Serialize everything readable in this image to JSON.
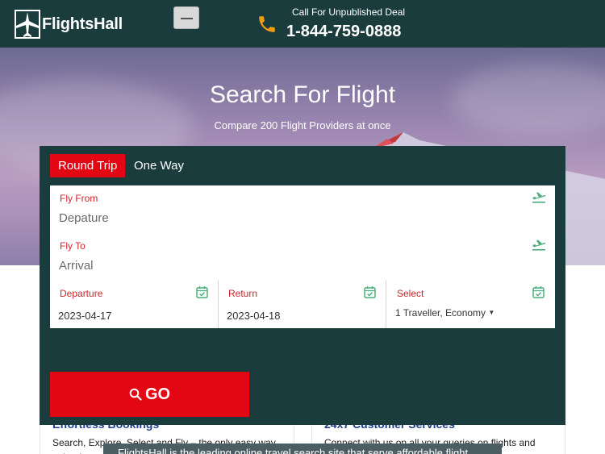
{
  "header": {
    "brand": "FlightsHall",
    "call_label": "Call For Unpublished Deal",
    "phone": "1-844-759-0888"
  },
  "hero": {
    "title": "Search For Flight",
    "subtitle": "Compare 200 Flight Providers at once"
  },
  "search": {
    "tabs": [
      {
        "label": "Round Trip",
        "active": true
      },
      {
        "label": "One Way",
        "active": false
      }
    ],
    "fly_from": {
      "label": "Fly From",
      "placeholder": "Depature"
    },
    "fly_to": {
      "label": "Fly To",
      "placeholder": "Arrival"
    },
    "departure": {
      "label": "Departure",
      "value": "2023-04-17"
    },
    "return": {
      "label": "Return",
      "value": "2023-04-18"
    },
    "travellers": {
      "label": "Select",
      "value": "1 Traveller, Economy"
    },
    "go_label": "GO"
  },
  "info": [
    {
      "title": "Effortless Bookings",
      "desc": "Search, Explore, Select and Fly – the only easy way to book your"
    },
    {
      "title": "24x7 Customer Services",
      "desc": "Connect with us on all your queries on flights and"
    }
  ],
  "cookie_text": "FlightsHall is the leading online travel search site that serve affordable flight",
  "colors": {
    "header_bg": "#1b3c3d",
    "accent_red": "#e30613",
    "label_red": "#d0262a",
    "icon_green": "#4caf7a",
    "phone_orange": "#f39c12"
  },
  "icons": {
    "logo": "airplane-icon",
    "menu": "hamburger-icon",
    "phone": "phone-icon",
    "plane": "plane-departure-icon",
    "calendar": "calendar-check-icon",
    "search": "search-icon",
    "caret": "caret-down-icon"
  }
}
